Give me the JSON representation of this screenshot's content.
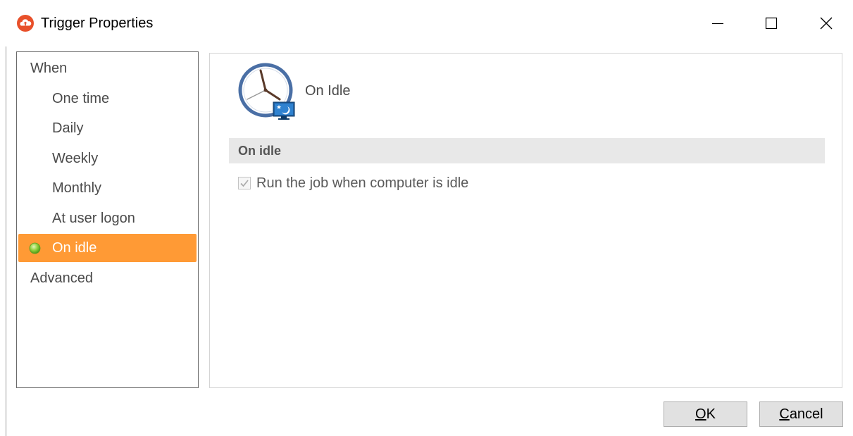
{
  "window": {
    "title": "Trigger Properties",
    "accent_color": "#ff9a35",
    "app_icon": "cloud-upload-icon"
  },
  "nav": {
    "items": [
      {
        "label": "When",
        "level": 0,
        "selected": false
      },
      {
        "label": "One time",
        "level": 1,
        "selected": false
      },
      {
        "label": "Daily",
        "level": 1,
        "selected": false
      },
      {
        "label": "Weekly",
        "level": 1,
        "selected": false
      },
      {
        "label": "Monthly",
        "level": 1,
        "selected": false
      },
      {
        "label": "At user logon",
        "level": 1,
        "selected": false
      },
      {
        "label": "On idle",
        "level": 1,
        "selected": true,
        "icon": "green-status-dot-icon"
      },
      {
        "label": "Advanced",
        "level": 0,
        "selected": false
      }
    ]
  },
  "content": {
    "header_title": "On Idle",
    "header_icon": "clock-idle-icon",
    "section_title": "On idle",
    "checkbox": {
      "label": "Run the job when computer is idle",
      "checked": true,
      "disabled": true
    }
  },
  "buttons": {
    "ok_mnemonic": "O",
    "ok_rest": "K",
    "cancel_mnemonic": "C",
    "cancel_rest": "ancel"
  }
}
